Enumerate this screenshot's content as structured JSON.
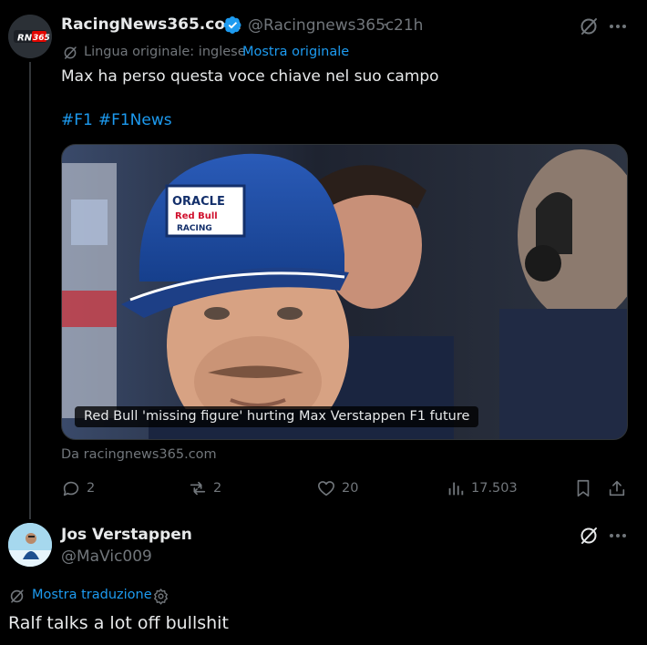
{
  "tweet": {
    "author_name": "RacingNews365.com",
    "handle": "@Racingnews365c",
    "separator": "·",
    "time": "21h",
    "avatar_text": "RN 365",
    "original_language_label": "Lingua originale: inglese",
    "show_original_link": "Mostra originale",
    "text": "Max ha perso questa voce chiave nel suo campo",
    "hashtags": [
      "#F1",
      "#F1News"
    ],
    "media_caption": "Red Bull 'missing figure' hurting Max Verstappen F1 future",
    "cap_lettering": [
      "ORACLE",
      "Red Bull",
      "RACING"
    ],
    "source": "Da racingnews365.com",
    "actions": {
      "replies": "2",
      "reposts": "2",
      "likes": "20",
      "views": "17.503"
    }
  },
  "reply": {
    "author_name": "Jos Verstappen",
    "handle": "@MaVic009",
    "show_translation_link": "Mostra traduzione",
    "text": "Ralf talks a lot off bullshit"
  },
  "colors": {
    "background": "#000000",
    "text": "#e7e9ea",
    "muted": "#71767b",
    "accent": "#1d9bf0",
    "cap_blue": "#1f4fa6"
  },
  "icons": [
    "verified-badge-icon",
    "grok-icon",
    "more-icon",
    "translate-icon",
    "reply-icon",
    "repost-icon",
    "like-icon",
    "views-icon",
    "bookmark-icon",
    "share-icon",
    "gear-icon"
  ]
}
